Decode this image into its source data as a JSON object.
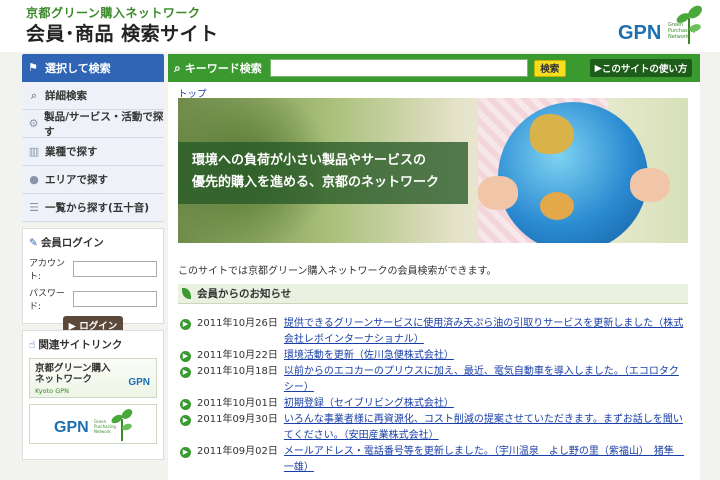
{
  "header": {
    "subtitle": "京都グリーン購入ネットワーク",
    "title": "会員･商品 検索サイト",
    "logo_text": "GPN",
    "logo_small": "Green Purchasing Network"
  },
  "sidebar": {
    "head": "選択して検索",
    "items": [
      {
        "label": "詳細検索",
        "icon": "search-icon"
      },
      {
        "label": "製品/サービス・活動で探す",
        "icon": "gears-icon"
      },
      {
        "label": "業種で探す",
        "icon": "building-icon"
      },
      {
        "label": "エリアで探す",
        "icon": "map-pin-icon"
      },
      {
        "label": "一覧から探す(五十音)",
        "icon": "list-icon"
      }
    ]
  },
  "login": {
    "title": "会員ログイン",
    "account_label": "アカウント:",
    "password_label": "パスワード:",
    "button": "ログイン"
  },
  "related": {
    "title": "関連サイトリンク",
    "banner1_line1": "京都グリーン購入",
    "banner1_line2": "ネットワーク",
    "banner1_sub": "Kyoto GPN",
    "banner1_logo": "GPN",
    "banner2_logo": "GPN",
    "banner2_small": "Green Purchasing Network"
  },
  "search": {
    "label": "キーワード検索",
    "value": "",
    "button": "検索",
    "howto": "このサイトの使い方"
  },
  "main": {
    "breadcrumb": "トップ",
    "hero_line1": "環境への負荷が小さい製品やサービスの",
    "hero_line2": "優先的購入を進める、京都のネットワーク",
    "intro": "このサイトでは京都グリーン購入ネットワークの会員検索ができます。",
    "news_title": "会員からのお知らせ",
    "news": [
      {
        "date": "2011年10月26日",
        "text": "提供できるグリーンサービスに使用済み天ぷら油の引取りサービスを更新しました（株式会社レボインターナショナル）"
      },
      {
        "date": "2011年10月22日",
        "text": "環境活動を更新（佐川急便株式会社）"
      },
      {
        "date": "2011年10月18日",
        "text": "以前からのエコカーのプリウスに加え、最近、電気自動車を導入しました。（エコロタクシー）"
      },
      {
        "date": "2011年10月01日",
        "text": "初期登録（セイブリビング株式会社）"
      },
      {
        "date": "2011年09月30日",
        "text": "いろんな事業者様に再資源化、コスト削減の提案させていただきます。まずお話しを聞いてください。（安田産業株式会社）"
      },
      {
        "date": "2011年09月02日",
        "text": "メールアドレス・電話番号等を更新しました。（宇川温泉　よし野の里（紫福山）　猪隼　一雄）"
      }
    ]
  }
}
